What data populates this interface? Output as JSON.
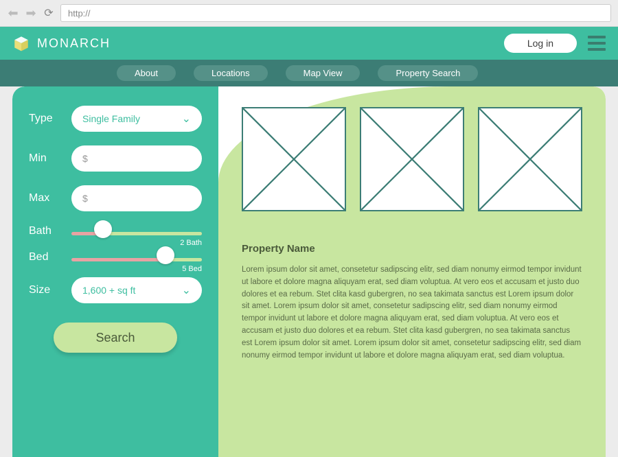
{
  "browser": {
    "url_placeholder": "http://"
  },
  "header": {
    "brand": "MONARCH",
    "login_label": "Log in"
  },
  "nav": {
    "tabs": [
      "About",
      "Locations",
      "Map View",
      "Property Search"
    ]
  },
  "filters": {
    "type": {
      "label": "Type",
      "value": "Single Family"
    },
    "min": {
      "label": "Min",
      "placeholder": "$"
    },
    "max": {
      "label": "Max",
      "placeholder": "$"
    },
    "bath": {
      "label": "Bath",
      "value_text": "2 Bath",
      "value": 2
    },
    "bed": {
      "label": "Bed",
      "value_text": "5 Bed",
      "value": 5
    },
    "size": {
      "label": "Size",
      "value": "1,600 + sq ft"
    },
    "search_label": "Search"
  },
  "property": {
    "title": "Property Name",
    "description": "Lorem ipsum dolor sit amet, consetetur sadipscing elitr, sed diam nonumy eirmod tempor invidunt ut labore et dolore magna aliquyam erat, sed diam voluptua. At vero eos et accusam et justo duo dolores et ea rebum. Stet clita kasd gubergren, no sea takimata sanctus est Lorem ipsum dolor sit amet. Lorem ipsum dolor sit amet, consetetur sadipscing elitr, sed diam nonumy eirmod tempor invidunt ut labore et dolore magna aliquyam erat, sed diam voluptua. At vero eos et accusam et justo duo dolores et ea rebum. Stet clita kasd gubergren, no sea takimata sanctus est Lorem ipsum dolor sit amet. Lorem ipsum dolor sit amet, consetetur sadipscing elitr, sed diam nonumy eirmod tempor invidunt ut labore et dolore magna aliquyam erat, sed diam voluptua."
  }
}
